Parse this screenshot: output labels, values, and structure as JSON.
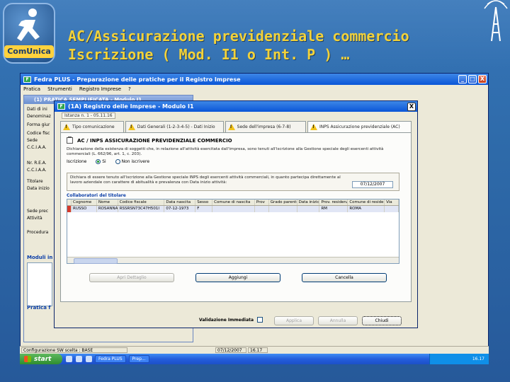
{
  "slide": {
    "title_line1": "AC/Assicurazione previdenziale commercio",
    "title_line2": "Iscrizione ( Mod. I1 o Int. P ) …",
    "logo_text": "ComUnica",
    "accent": "#f2d23a"
  },
  "app_window": {
    "title": "Fedra PLUS - Preparazione delle pratiche per il Registro Imprese",
    "menu": [
      "Pratica",
      "Strumenti",
      "Registro Imprese",
      "?"
    ],
    "controls": [
      "_",
      "□",
      "X"
    ]
  },
  "child_window": {
    "title": "(1) PRATICA SEMPLIFICATA - Modulo I1",
    "left_labels": [
      "Dati di ini",
      "Denominaz",
      "Forma giur",
      "Codice fisc",
      "Sede",
      "C.C.I.A.A.",
      "Nr. R.E.A.",
      "C.C.I.A.A.",
      "Titolare",
      "Data inizio",
      "Sede prec",
      "Attività",
      "Procedura"
    ],
    "sections": [
      "Moduli in",
      "Pratica f"
    ]
  },
  "dialog": {
    "title": "(1A) Registro delle Imprese - Modulo I1",
    "code": "Istanza n. 1 - 05.11.16",
    "tabs": [
      "Tipo comunicazione",
      "Dati Generali (1-2-3-4-5) - Dati Inizio",
      "Sede dell'impresa (6-7-8)",
      "INPS Assicurazione previdenziale (AC)"
    ],
    "section_title": "AC / INPS ASSICURAZIONE PREVIDENZIALE COMMERCIO",
    "description": "Dichiarazione della esistenza di soggetti che, in relazione all'attività esercitata dall'impresa, sono tenuti all'iscrizione alla Gestione speciale degli esercenti attività commerciali (L. 662/96, art. 1, c. 203).",
    "radio_label": "Iscrizione",
    "radio_options": [
      "Si",
      "Non iscrivere"
    ],
    "radio_selected": 0,
    "declaration": "Dichiara di essere tenuto all'iscrizione alla Gestione speciale INPS degli esercenti attività commerciali, in quanto partecipa direttamente al lavoro aziendale con carattere di abitualità e prevalenza con Data inizio attività:",
    "declaration_lead": "Dichiara",
    "date_value": "07/12/2007",
    "collab_label": "Collaboratori del titolare",
    "grid_columns": [
      "Cognome",
      "Nome",
      "Codice fiscale",
      "Data nascita",
      "Sesso",
      "Comune di nascita",
      "Prov",
      "Grado parentela",
      "Data inizio",
      "Prov. residenza",
      "Comune di residenza",
      "Via"
    ],
    "grid_rows": [
      [
        "RUSSO",
        "ROSANNA",
        "RSSRSN73C47H501I",
        "07-12-1973",
        "F",
        "",
        "",
        "",
        "",
        "RM",
        "ROMA",
        ""
      ]
    ],
    "panel_buttons": [
      "Apri Dettaglio",
      "Aggiungi",
      "Cancella"
    ],
    "validation_label": "Validazione Immediata",
    "footer_buttons": [
      "Applica",
      "Annulla",
      "Chiudi"
    ]
  },
  "statusbar": {
    "config": "Configurazione SW scelta : BASE",
    "date": "07/12/2007",
    "time": "16.17"
  },
  "taskbar": {
    "start": "start",
    "tasks": [
      "Fedra PLUS",
      "Prep..."
    ],
    "clock": "16.17"
  }
}
